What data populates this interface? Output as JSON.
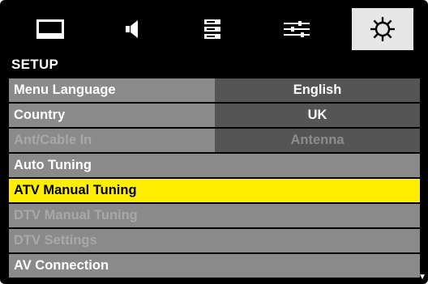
{
  "menu_icons": [
    {
      "name": "picture-icon"
    },
    {
      "name": "sound-icon"
    },
    {
      "name": "channel-list-icon"
    },
    {
      "name": "features-icon"
    },
    {
      "name": "setup-gear-icon"
    }
  ],
  "section_title": "SETUP",
  "rows": {
    "menu_language": {
      "label": "Menu Language",
      "value": "English"
    },
    "country": {
      "label": "Country",
      "value": "UK"
    },
    "ant_cable_in": {
      "label": "Ant/Cable In",
      "value": "Antenna"
    },
    "auto_tuning": {
      "label": "Auto Tuning"
    },
    "atv_manual_tuning": {
      "label": "ATV Manual Tuning"
    },
    "dtv_manual_tuning": {
      "label": "DTV Manual Tuning"
    },
    "dtv_settings": {
      "label": "DTV Settings"
    },
    "av_connection": {
      "label": "AV Connection"
    }
  },
  "scroll_indicator": "▼",
  "colors": {
    "background": "#000000",
    "row": "#8a8a8a",
    "value_cell": "#555555",
    "highlight": "#ffee00",
    "selected_tab": "#e6e6e6"
  }
}
